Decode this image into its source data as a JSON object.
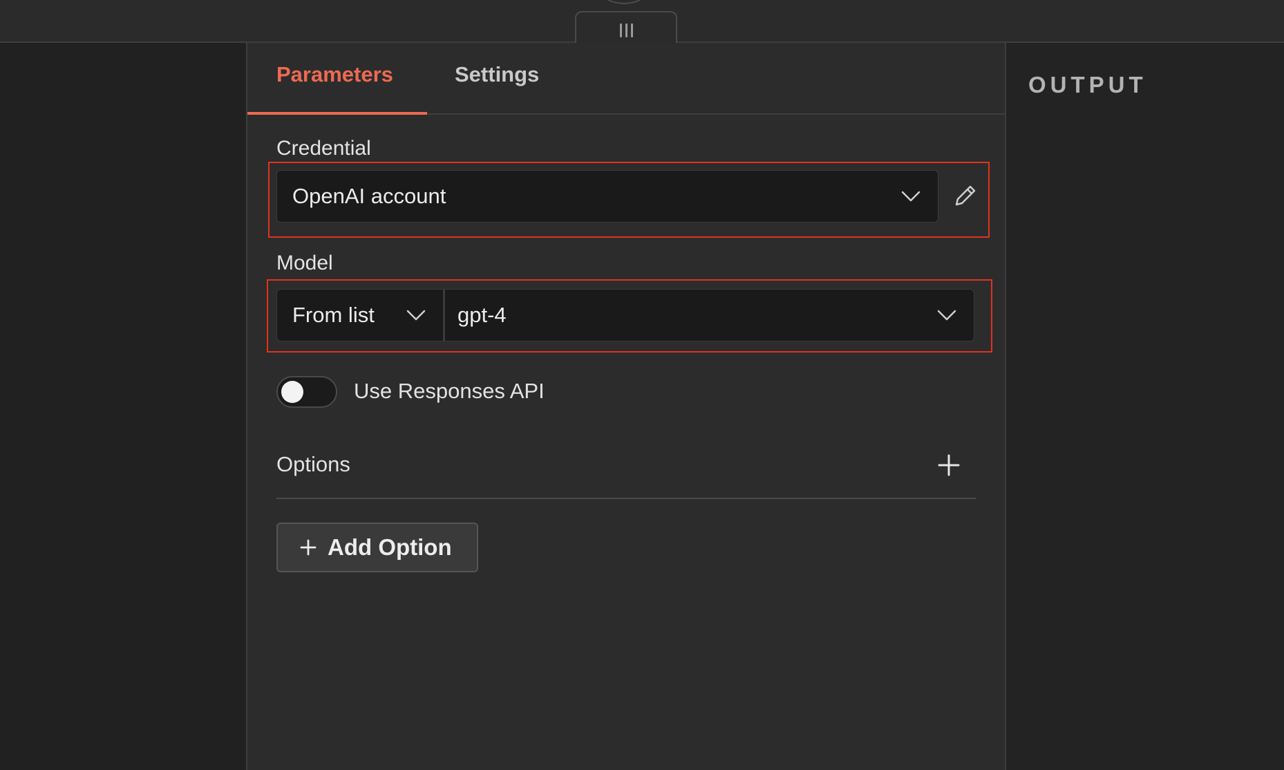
{
  "tabs": [
    {
      "label": "Parameters",
      "active": true
    },
    {
      "label": "Settings",
      "active": false
    }
  ],
  "credential": {
    "label": "Credential",
    "value": "OpenAI account"
  },
  "model": {
    "label": "Model",
    "mode_value": "From list",
    "value": "gpt-4"
  },
  "responses_api": {
    "label": "Use Responses API",
    "enabled": false
  },
  "options": {
    "label": "Options",
    "add_button_label": "Add Option"
  },
  "output": {
    "title": "OUTPUT"
  },
  "icons": {
    "drag_handle": "drag-handle-icon",
    "chevron": "chevron-down-icon",
    "edit": "pencil-icon",
    "plus": "plus-icon"
  },
  "colors": {
    "accent": "#ee6a53",
    "highlight": "#e0321f",
    "panel_bg": "#2c2c2c",
    "input_bg": "#1a1a1a"
  }
}
